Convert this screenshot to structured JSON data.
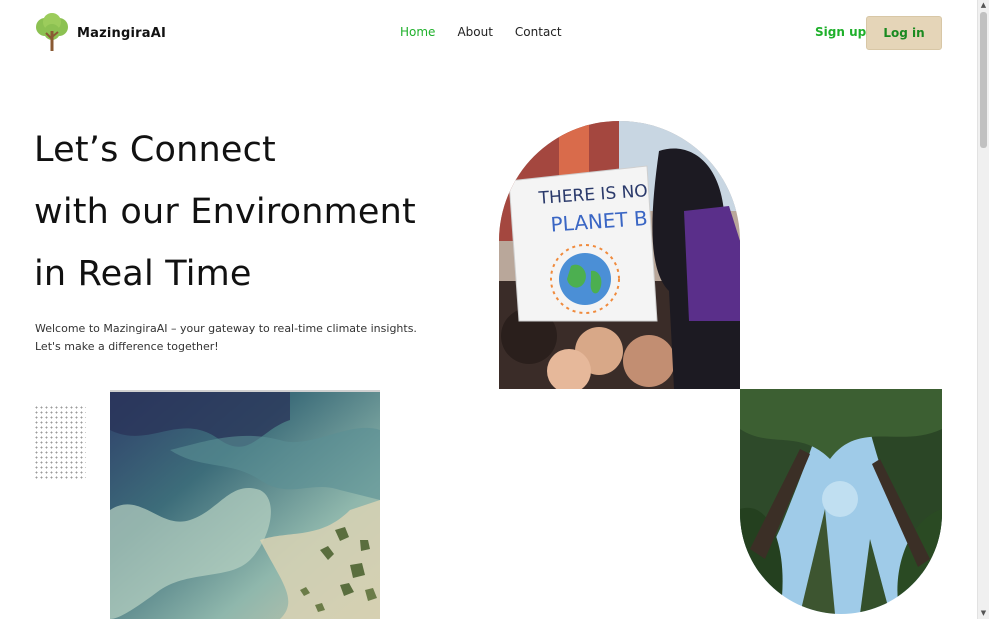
{
  "brand": {
    "name": "MazingiraAI",
    "logo_icon": "tree-icon",
    "accent": "#1fb02b"
  },
  "nav": {
    "items": [
      {
        "label": "Home",
        "active": true
      },
      {
        "label": "About",
        "active": false
      },
      {
        "label": "Contact",
        "active": false
      }
    ]
  },
  "auth": {
    "signup_label": "Sign up",
    "login_label": "Log in",
    "login_bg": "#e5d5b8"
  },
  "hero": {
    "title_lines": [
      "Let’s Connect",
      "with our Environment",
      "in Real Time"
    ],
    "subtitle_lines": [
      "Welcome to MazingiraAI – your gateway to real-time climate insights.",
      "Let's make a difference together!"
    ]
  },
  "images": {
    "sea": "satellite-coastline-image",
    "protest": "climate-protest-image",
    "protest_sign": [
      "THERE IS NO",
      "PLANET B"
    ],
    "forest": "forest-canopy-image"
  },
  "scrollbar": {
    "up_icon": "▲",
    "down_icon": "▼"
  }
}
